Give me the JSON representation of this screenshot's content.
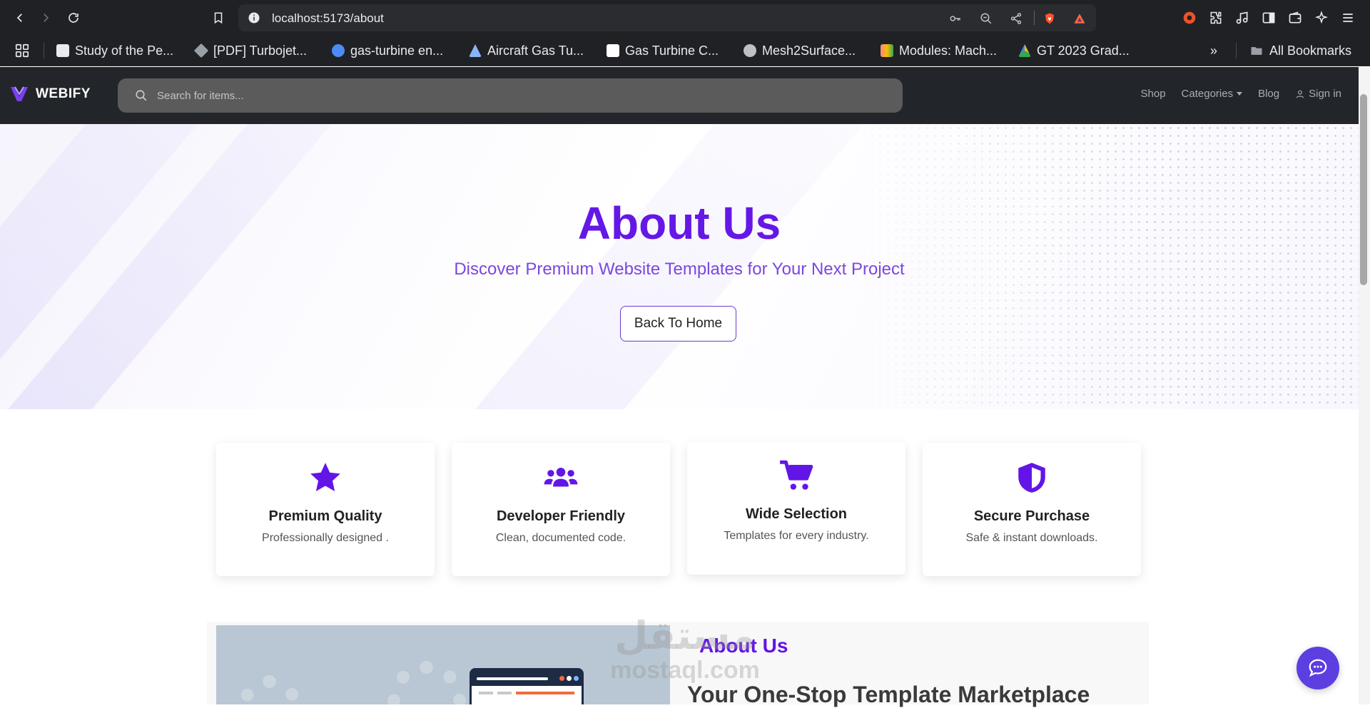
{
  "browser": {
    "url": "localhost:5173/about",
    "bookmarks": [
      {
        "label": "Study of the Pe...",
        "color": "#e8eaed"
      },
      {
        "label": "[PDF] Turbojet...",
        "color": "#9aa0a6"
      },
      {
        "label": "gas-turbine en...",
        "color": "#4c8bf5"
      },
      {
        "label": "Aircraft Gas Tu...",
        "color": "#8ab4f8"
      },
      {
        "label": "Gas Turbine C...",
        "color": "#ffffff"
      },
      {
        "label": "Mesh2Surface...",
        "color": "#bdc1c6"
      },
      {
        "label": "Modules: Mach...",
        "color": "#f28b82"
      },
      {
        "label": "GT 2023 Grad...",
        "color": "#fbbc04"
      }
    ],
    "more_label": "»",
    "all_bookmarks_label": "All Bookmarks"
  },
  "navbar": {
    "brand": "WEBIFY",
    "search_placeholder": "Search for items...",
    "links": {
      "shop": "Shop",
      "categories": "Categories",
      "blog": "Blog",
      "signin": "Sign in"
    }
  },
  "hero": {
    "title": "About Us",
    "subtitle": "Discover Premium Website Templates for Your Next Project",
    "button": "Back To Home"
  },
  "features": [
    {
      "icon": "star-icon",
      "title": "Premium Quality",
      "desc": "Professionally designed ."
    },
    {
      "icon": "users-icon",
      "title": "Developer Friendly",
      "desc": "Clean, documented code."
    },
    {
      "icon": "cart-icon",
      "title": "Wide Selection",
      "desc": "Templates for every industry."
    },
    {
      "icon": "shield-icon",
      "title": "Secure Purchase",
      "desc": "Safe & instant downloads."
    }
  ],
  "about": {
    "heading": "About Us",
    "subheading": "Your One-Stop Template Marketplace"
  },
  "watermark": {
    "arabic": "مستقل",
    "latin": "mostaql.com"
  },
  "colors": {
    "accent": "#6517e6",
    "navbar_bg": "#22252a",
    "chat_button": "#5d3ee0"
  }
}
